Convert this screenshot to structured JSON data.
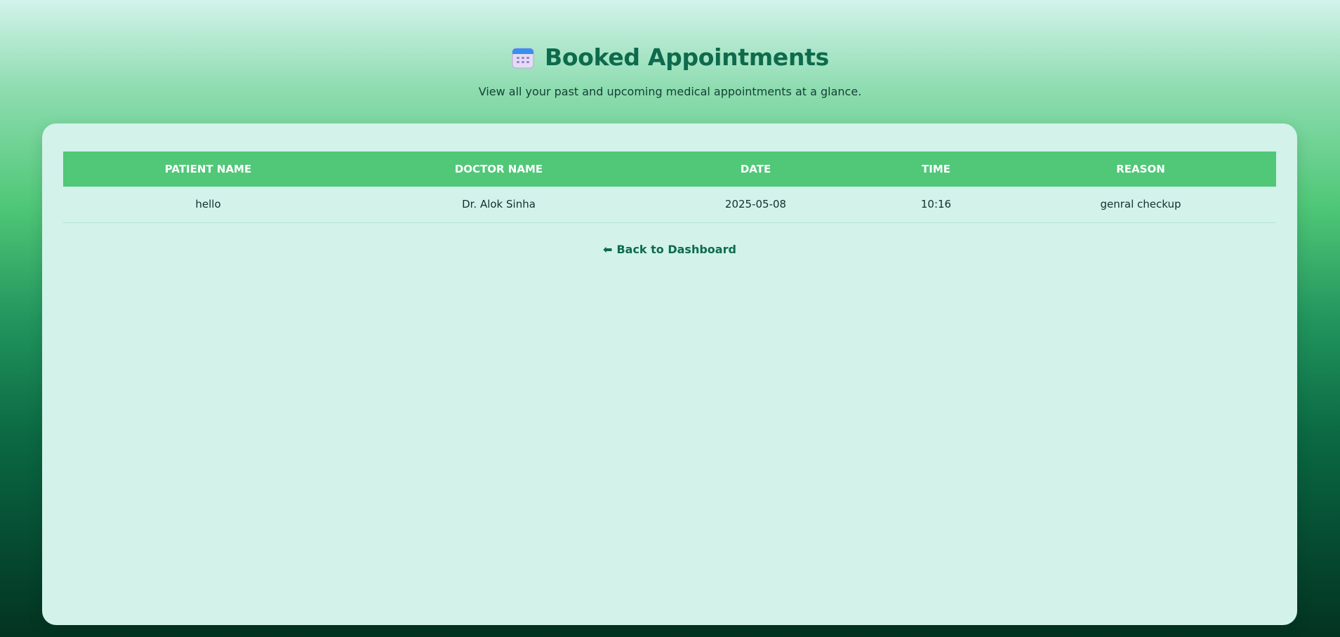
{
  "header": {
    "icon": "calendar-icon",
    "title": "Booked Appointments",
    "subtitle": "View all your past and upcoming medical appointments at a glance."
  },
  "table": {
    "columns": [
      "Patient Name",
      "Doctor Name",
      "Date",
      "Time",
      "Reason"
    ],
    "rows": [
      {
        "patient": "hello",
        "doctor": "Dr. Alok Sinha",
        "date": "2025-05-08",
        "time": "10:16",
        "reason": "genral checkup"
      }
    ]
  },
  "back_link": {
    "icon": "arrow-left-icon",
    "label": "Back to Dashboard"
  },
  "colors": {
    "accent": "#50c878",
    "title": "#0d6b4c",
    "card": "#d2f2ea"
  }
}
